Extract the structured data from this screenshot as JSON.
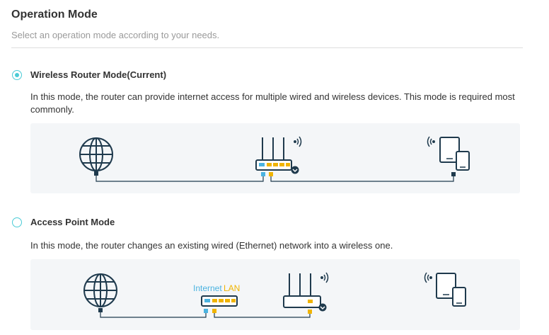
{
  "header": {
    "title": "Operation Mode",
    "subtitle": "Select an operation mode according to your needs."
  },
  "modes": [
    {
      "label": "Wireless Router Mode(Current)",
      "selected": true,
      "description": "In this mode, the router can provide internet access for multiple wired and wireless devices. This mode is required most commonly."
    },
    {
      "label": "Access Point Mode",
      "selected": false,
      "description": "In this mode, the router changes an existing wired (Ethernet) network into a wireless one.",
      "port_labels": {
        "internet": "Internet",
        "lan": "LAN"
      }
    }
  ],
  "colors": {
    "accent": "#4acbd6",
    "icon_navy": "#1f3a4d",
    "port_blue": "#4bb3e0",
    "port_yellow": "#f0b400",
    "diagram_bg": "#f4f6f8"
  },
  "icons": [
    "globe-icon",
    "router-icon",
    "wifi-signal-icon",
    "devices-icon"
  ]
}
